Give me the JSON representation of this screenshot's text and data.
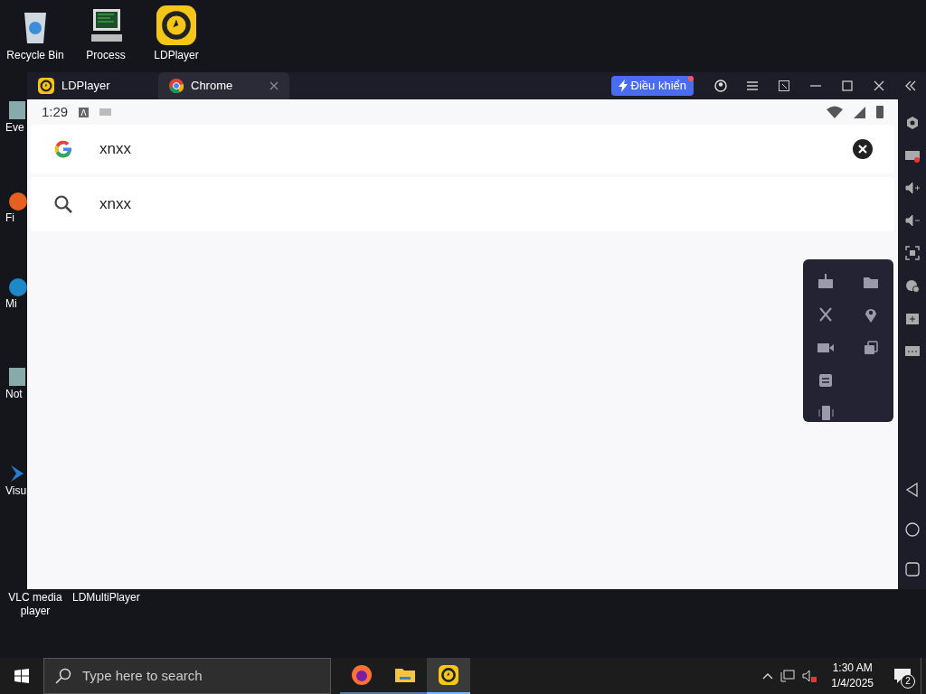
{
  "desktop_icons": [
    {
      "label": "Recycle Bin",
      "kind": "bin"
    },
    {
      "label": "Process",
      "kind": "monitor"
    },
    {
      "label": "LDPlayer",
      "kind": "ld"
    }
  ],
  "cut_icons": [
    {
      "label": "Eve",
      "kind": "app"
    },
    {
      "label": "Fi",
      "kind": "fox"
    },
    {
      "label": "Mi",
      "kind": "edge"
    },
    {
      "label": "Not",
      "kind": "app"
    },
    {
      "label": "Visu",
      "kind": "vs"
    },
    {
      "label": "VLC media player",
      "kind": "vlc"
    }
  ],
  "bottom_label": "LDMultiPlayer",
  "window": {
    "tabs": [
      {
        "label": "LDPlayer",
        "kind": "ld",
        "selected": false
      },
      {
        "label": "Chrome",
        "kind": "chrome",
        "selected": true
      }
    ],
    "control_button": "Điều khiển"
  },
  "status_bar": {
    "time": "1:29"
  },
  "search": {
    "value": "xnxx"
  },
  "suggestions": [
    {
      "text": "xnxx"
    }
  ],
  "taskbar": {
    "search_placeholder": "Type here to search",
    "apps": [
      {
        "kind": "firefox",
        "selected": false
      },
      {
        "kind": "folder",
        "selected": false
      },
      {
        "kind": "ld",
        "selected": true
      }
    ],
    "time": "1:30 AM",
    "date": "1/4/2025",
    "notifications": "2"
  }
}
